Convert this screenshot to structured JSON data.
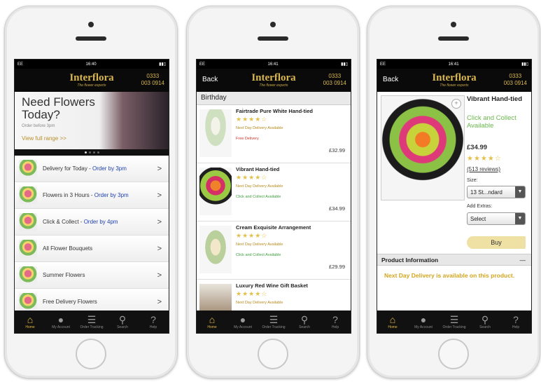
{
  "common": {
    "brand_name": "Interflora",
    "brand_tag": "The flower experts",
    "phone_line1": "0333",
    "phone_line2": "003 0914",
    "back_label": "Back",
    "tabs": [
      {
        "label": "Home",
        "icon": "home-icon"
      },
      {
        "label": "My Account",
        "icon": "account-icon"
      },
      {
        "label": "Order Tracking",
        "icon": "order-tracking-icon"
      },
      {
        "label": "Search",
        "icon": "search-icon"
      },
      {
        "label": "Help",
        "icon": "help-icon"
      }
    ],
    "accent_color": "#e2b93b"
  },
  "screen1": {
    "status": {
      "carrier": "EE",
      "time": "16:40"
    },
    "hero": {
      "headline": "Need Flowers Today?",
      "subtext": "Order before 3pm",
      "link": "View full range >>"
    },
    "menu": [
      {
        "label": "Delivery for Today - ",
        "highlight": "Order by 3pm"
      },
      {
        "label": "Flowers in 3 Hours - ",
        "highlight": "Order by 3pm"
      },
      {
        "label": "Click & Collect - ",
        "highlight": "Order by 4pm"
      },
      {
        "label": "All Flower Bouquets",
        "highlight": ""
      },
      {
        "label": "Summer Flowers",
        "highlight": ""
      },
      {
        "label": "Free Delivery Flowers",
        "highlight": ""
      }
    ]
  },
  "screen2": {
    "status": {
      "carrier": "EE",
      "time": "16:41"
    },
    "section": "Birthday",
    "products": [
      {
        "name": "Fairtrade Pure White Hand-tied",
        "rating": "★★★★☆",
        "delivery": "Next Day Delivery Available",
        "extra": "Free Delivery",
        "extra_color": "#d0342c",
        "price": "£32.99"
      },
      {
        "name": "Vibrant Hand-tied",
        "rating": "★★★★☆",
        "delivery": "Next Day Delivery Available",
        "extra": "Click and Collect Available",
        "extra_color": "#3e9e3e",
        "price": "£34.99"
      },
      {
        "name": "Cream Exquisite Arrangement",
        "rating": "★★★★☆",
        "delivery": "Next Day Delivery Available",
        "extra": "Click and Collect Available",
        "extra_color": "#3e9e3e",
        "price": "£29.99"
      },
      {
        "name": "Luxury Red Wine Gift Basket",
        "rating": "★★★★☆",
        "delivery": "Next Day Delivery Available",
        "extra": "",
        "extra_color": "#3e9e3e",
        "price": ""
      }
    ]
  },
  "screen3": {
    "status": {
      "carrier": "EE",
      "time": "16:41"
    },
    "product_name": "Vibrant Hand-tied",
    "collect": "Click and Collect Available",
    "price": "£34.99",
    "rating": "★★★★☆",
    "reviews": "(513 reviews)",
    "size_label": "Size:",
    "size_value": "13 St...ndard",
    "extras_label": "Add Extras:",
    "extras_value": "Select",
    "buy_label": "Buy",
    "info_title": "Product Information",
    "info_toggle": "—",
    "info_note": "Next Day Delivery is available on this product."
  }
}
